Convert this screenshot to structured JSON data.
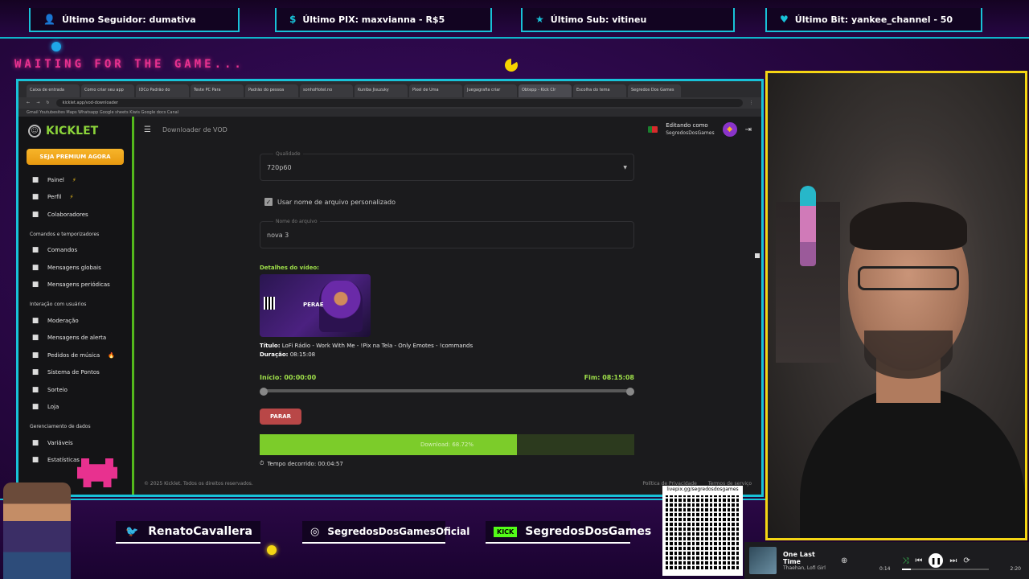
{
  "overlay": {
    "alerts": [
      {
        "icon": "user-icon",
        "text": "Último Seguidor: dumativa"
      },
      {
        "icon": "dollar-icon",
        "text": "Último PIX: maxvianna - R$5"
      },
      {
        "icon": "star-icon",
        "text": "Último Sub: vitineu"
      },
      {
        "icon": "heart-icon",
        "text": "Último Bit: yankee_channel - 50"
      }
    ],
    "waiting_text": "WAITING FOR THE GAME...",
    "socials": [
      {
        "icon": "twitter-icon",
        "handle": "RenatoCavallera"
      },
      {
        "icon": "instagram-icon",
        "handle": "SegredosDosGamesOficial"
      },
      {
        "icon": "kick-icon",
        "logo": "KICK",
        "handle": "SegredosDosGames"
      }
    ],
    "qr_url": "livepix.gg/segredosdosgames"
  },
  "browser": {
    "tabs": [
      "Caixa de entrada",
      "Como criar seu app",
      "IDCo Padrão do",
      "Teste PC Para",
      "Padrão do pessoa",
      "sonhoHotel.no",
      "Kuniba Jisuzuky",
      "Pixel de Uma",
      "Juegagrafia criar",
      "Obtepp - Kick Clr",
      "Escolha do tema",
      "Segredos Dos Games"
    ],
    "active_tab": 9,
    "url": "kicklet.app/vod-downloader",
    "bookmarks": "Gmail   Youtubesites   Maps   Whatsapp   Google sheets   Kiwis   Google docs   Canal"
  },
  "app": {
    "brand": "KICKLET",
    "premium_label": "SEJA PREMIUM AGORA",
    "nav": [
      {
        "icon": "dashboard-icon",
        "label": "Painel",
        "badge": "⚡"
      },
      {
        "icon": "profile-icon",
        "label": "Perfil",
        "badge": "⚡"
      },
      {
        "icon": "collaborators-icon",
        "label": "Colaboradores",
        "badge": ""
      }
    ],
    "section_commands": "Comandos e temporizadores",
    "nav_commands": [
      {
        "icon": "commands-icon",
        "label": "Comandos"
      },
      {
        "icon": "global-messages-icon",
        "label": "Mensagens globais"
      },
      {
        "icon": "timer-icon",
        "label": "Mensagens periódicas"
      }
    ],
    "section_interaction": "Interação com usuários",
    "nav_interaction": [
      {
        "icon": "shield-icon",
        "label": "Moderação",
        "badge": ""
      },
      {
        "icon": "alert-icon",
        "label": "Mensagens de alerta",
        "badge": ""
      },
      {
        "icon": "music-icon",
        "label": "Pedidos de música",
        "badge": "🔥"
      },
      {
        "icon": "star-icon",
        "label": "Sistema de Pontos",
        "badge": ""
      },
      {
        "icon": "gift-icon",
        "label": "Sorteio",
        "badge": ""
      },
      {
        "icon": "cart-icon",
        "label": "Loja",
        "badge": ""
      }
    ],
    "section_data": "Gerenciamento de dados",
    "nav_data": [
      {
        "icon": "variables-icon",
        "label": "Variáveis"
      },
      {
        "icon": "stats-icon",
        "label": "Estatísticas"
      }
    ],
    "page_title": "Downloader de VOD",
    "editing_as": "Editando como",
    "username": "SegredosDosGames",
    "quality_label": "Qualidade",
    "quality_value": "720p60",
    "custom_name_label": "Usar nome de arquivo personalizado",
    "custom_name_checked": true,
    "filename_label": "Nome do arquivo",
    "filename_value": "nova 3",
    "details_title": "Detalhes do vídeo:",
    "thumb_caption": "PERAE",
    "video_title_label": "Título:",
    "video_title": "LoFi Rádio - Work With Me - !Pix na Tela - Only Emotes - !commands",
    "duration_label": "Duração:",
    "duration": "08:15:08",
    "start_label": "Início: 00:00:00",
    "end_label": "Fim: 08:15:08",
    "range_start": 0,
    "range_end": 1,
    "stop_label": "PARAR",
    "progress_fraction": 0.6872,
    "progress_text": "Download: 68.72%",
    "elapsed_text": "Tempo decorrido: 00:04:57",
    "footer_copy": "© 2025 Kicklet. Todos os direitos reservados.",
    "footer_links": [
      "Política de Privacidade",
      "Termos de serviço"
    ]
  },
  "player": {
    "song": "One Last Time",
    "artist": "Thaehan, Lofi Girl",
    "current_time": "0:14",
    "total_time": "2:20",
    "progress_fraction": 0.1
  },
  "colors": {
    "accent_cyan": "#18c2d8",
    "kicklet_green": "#8bd33a",
    "progress_green": "#7ccc2a",
    "premium_orange": "#f7b52a",
    "stop_red": "#b94747",
    "webcam_border": "#f5d614"
  }
}
